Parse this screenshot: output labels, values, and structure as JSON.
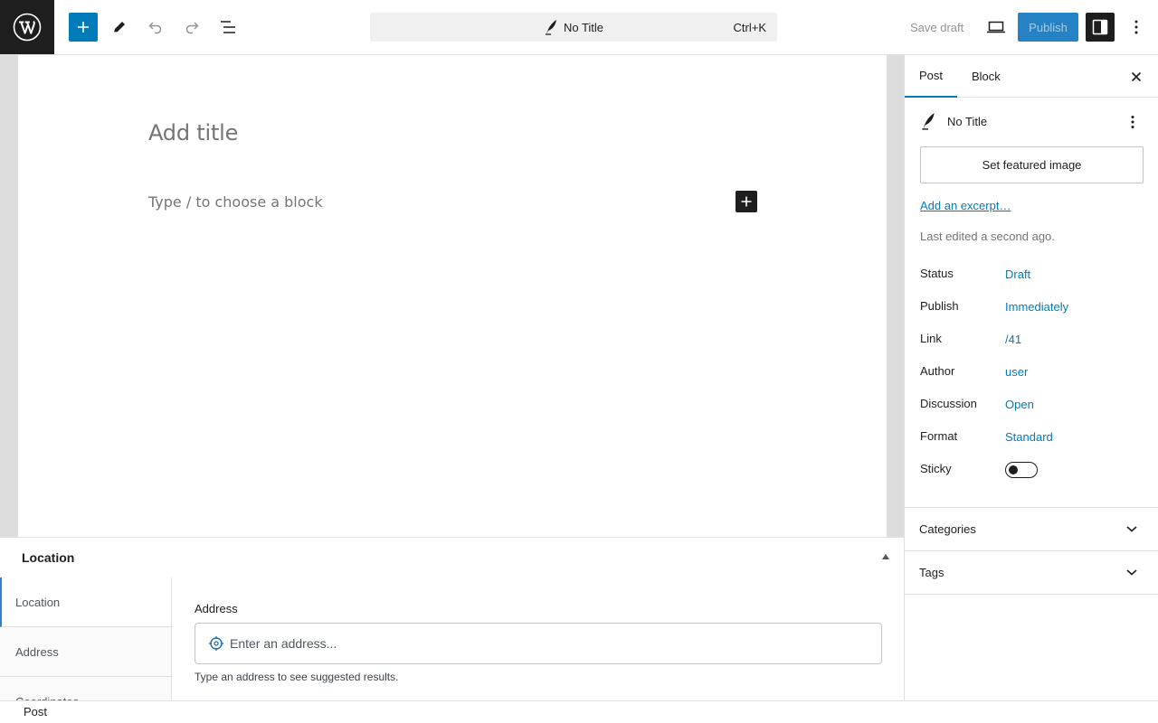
{
  "toolbar": {
    "logo_icon": "wordpress-logo-icon",
    "add_block_icon": "plus-icon",
    "tools_icon": "pencil-icon",
    "undo_icon": "undo-icon",
    "redo_icon": "redo-icon",
    "document_overview_icon": "list-view-icon",
    "command_bar": {
      "title": "No Title",
      "shortcut": "Ctrl+K",
      "icon": "post-feather-icon"
    },
    "save_draft_label": "Save draft",
    "preview_icon": "desktop-preview-icon",
    "publish_label": "Publish",
    "settings_icon": "sidebar-toggle-icon",
    "options_icon": "more-vertical-icon",
    "accent_color": "#007cba"
  },
  "editor": {
    "title_placeholder": "Add title",
    "block_placeholder": "Type / to choose a block",
    "inline_inserter_icon": "plus-icon"
  },
  "metabox": {
    "title": "Location",
    "toggle_icon": "triangle-up-icon",
    "tabs": [
      {
        "label": "Location"
      },
      {
        "label": "Address"
      },
      {
        "label": "Coordinates"
      }
    ],
    "address_label": "Address",
    "address_placeholder": "Enter an address...",
    "address_value": "",
    "hint": "Type an address to see suggested results."
  },
  "sidebar": {
    "tabs": {
      "post": "Post",
      "block": "Block"
    },
    "close_icon": "close-icon",
    "document": {
      "title": "No Title",
      "icon": "post-feather-icon"
    },
    "featured_image_label": "Set featured image",
    "excerpt_link": "Add an excerpt…",
    "last_edited": "Last edited a second ago.",
    "rows": [
      {
        "label": "Status",
        "value": "Draft"
      },
      {
        "label": "Publish",
        "value": "Immediately"
      },
      {
        "label": "Link",
        "value": "/41"
      },
      {
        "label": "Author",
        "value": "user"
      },
      {
        "label": "Discussion",
        "value": "Open"
      },
      {
        "label": "Format",
        "value": "Standard"
      }
    ],
    "sticky": {
      "label": "Sticky",
      "checked": false
    },
    "panels": [
      {
        "label": "Categories"
      },
      {
        "label": "Tags"
      }
    ]
  },
  "footer": {
    "breadcrumb": "Post"
  }
}
